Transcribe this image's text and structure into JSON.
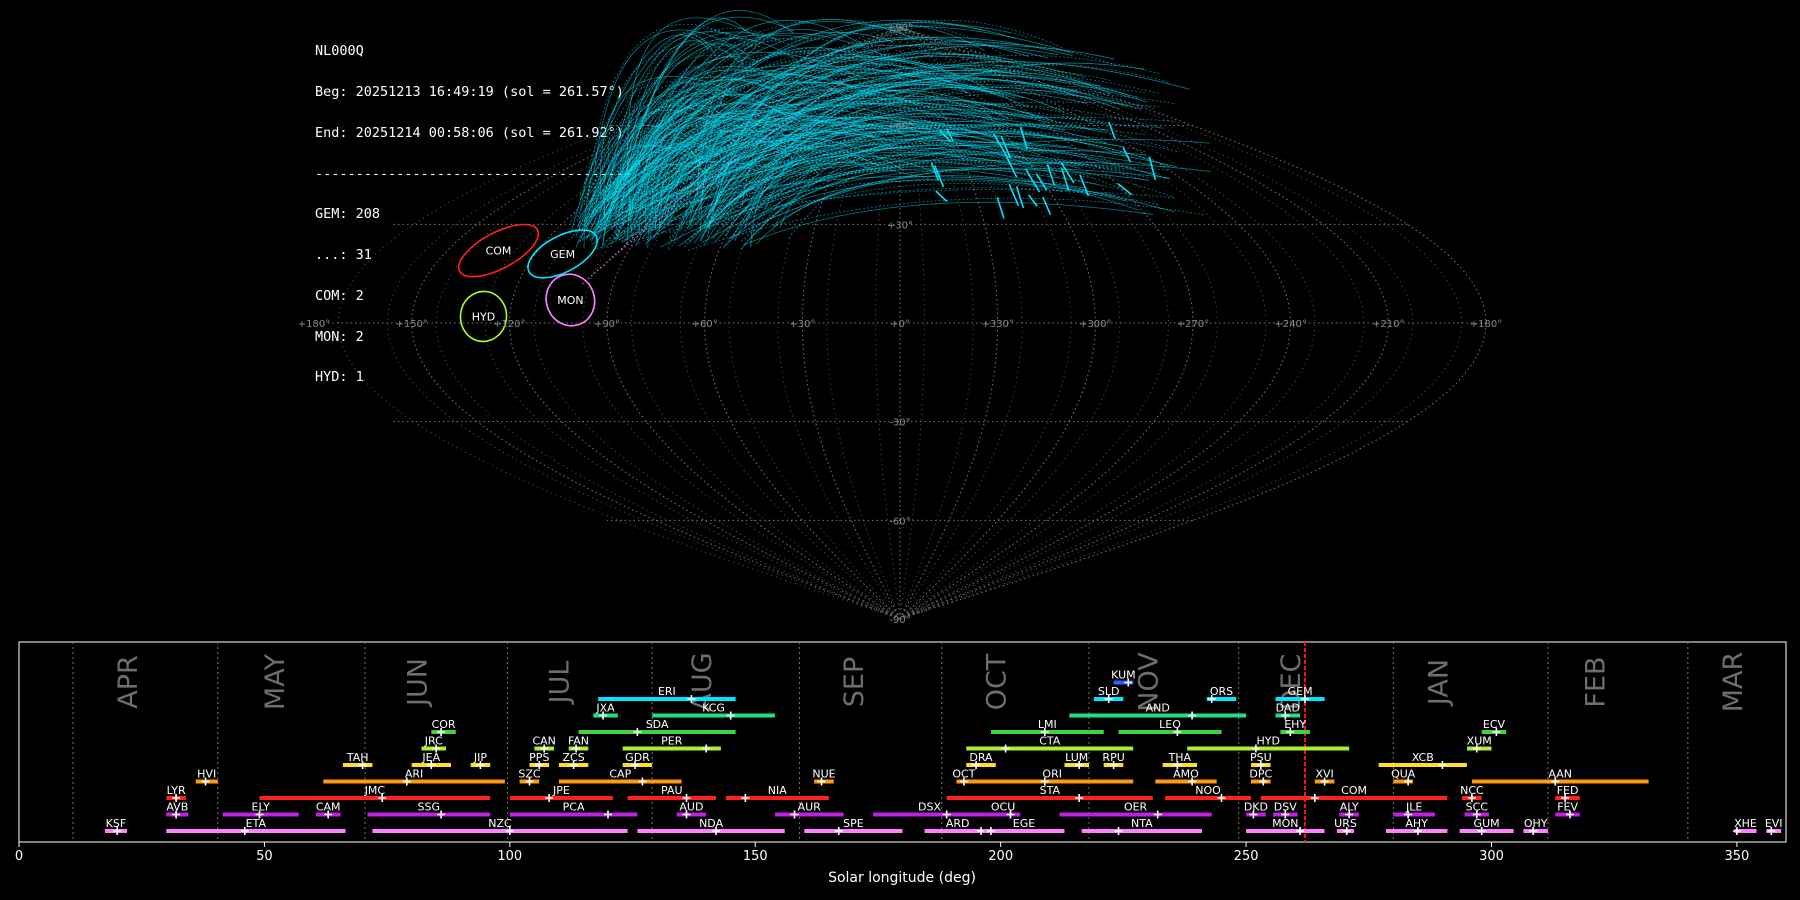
{
  "stats": {
    "station": "NL000Q",
    "begin": "Beg: 20251213 16:49:19 (sol = 261.57°)",
    "end": "End: 20251214 00:58:06 (sol = 261.92°)",
    "separator": "---------------------------------------",
    "counts": [
      "GEM: 208",
      "...: 31",
      "COM: 2",
      "MON: 2",
      "HYD: 1"
    ]
  },
  "chart_data": [
    {
      "type": "scatter",
      "projection": "sinusoidal",
      "grid": true,
      "lon_tick_labels": [
        "+180°",
        "+150°",
        "+120°",
        "+90°",
        "+60°",
        "+30°",
        "+0°",
        "+330°",
        "+300°",
        "+270°",
        "+240°",
        "+210°",
        "+180°"
      ],
      "lat_tick_labels": [
        "+90°",
        "+60°",
        "+30°",
        "-30°",
        "-60°",
        "-90°"
      ],
      "radiants": [
        {
          "code": "COM",
          "color": "#ff2020",
          "ra": 133,
          "dec": 22
        },
        {
          "code": "GEM",
          "color": "#00e5ff",
          "ra": 111,
          "dec": 21
        },
        {
          "code": "MON",
          "color": "#ff80ff",
          "ra": 102,
          "dec": 7
        },
        {
          "code": "HYD",
          "color": "#b0ff20",
          "ra": 128,
          "dec": 2
        }
      ],
      "colors": {
        "sporadic": "#ff80ff",
        "gem": "#00e5ff"
      }
    },
    {
      "type": "bar",
      "orientation": "horizontal",
      "xlabel": "Solar longitude (deg)",
      "xlim": [
        0,
        360
      ],
      "x_ticks": [
        0,
        50,
        100,
        150,
        200,
        250,
        300,
        350
      ],
      "months": [
        {
          "label": "APR",
          "center": 24
        },
        {
          "label": "MAY",
          "center": 54
        },
        {
          "label": "JUN",
          "center": 83
        },
        {
          "label": "JUL",
          "center": 112
        },
        {
          "label": "AUG",
          "center": 141
        },
        {
          "label": "SEP",
          "center": 172
        },
        {
          "label": "OCT",
          "center": 201
        },
        {
          "label": "NOV",
          "center": 232
        },
        {
          "label": "DEC",
          "center": 261
        },
        {
          "label": "JAN",
          "center": 291
        },
        {
          "label": "FEB",
          "center": 323
        },
        {
          "label": "MAR",
          "center": 351
        }
      ],
      "month_boundaries": [
        11,
        40.5,
        70.5,
        99.5,
        129,
        159,
        188,
        218,
        248.5,
        280,
        311.5,
        340
      ],
      "current_sol": 262,
      "showers": [
        {
          "code": "KSF",
          "start": 17.5,
          "end": 22,
          "peak": 20,
          "row": 0,
          "color": "#ff80ff"
        },
        {
          "code": "ETA",
          "start": 30,
          "end": 66.5,
          "peak": 46,
          "row": 0,
          "color": "#ff80ff"
        },
        {
          "code": "NZC",
          "start": 72,
          "end": 124,
          "peak": 100,
          "row": 0,
          "color": "#ff80ff"
        },
        {
          "code": "NDA",
          "start": 126,
          "end": 156,
          "peak": 142,
          "row": 0,
          "color": "#ff80ff"
        },
        {
          "code": "SPE",
          "start": 160,
          "end": 180,
          "peak": 167,
          "row": 0,
          "color": "#ff80ff"
        },
        {
          "code": "ARD",
          "start": 184.5,
          "end": 198,
          "peak": 196,
          "row": 0,
          "color": "#ff80ff"
        },
        {
          "code": "EGE",
          "start": 196.5,
          "end": 213,
          "peak": 198,
          "row": 0,
          "color": "#ff80ff"
        },
        {
          "code": "NTA",
          "start": 216.5,
          "end": 241,
          "peak": 224,
          "row": 0,
          "color": "#ff80ff"
        },
        {
          "code": "MON",
          "start": 250,
          "end": 266,
          "peak": 261,
          "row": 0,
          "color": "#ff80ff"
        },
        {
          "code": "URS",
          "start": 268.5,
          "end": 272,
          "peak": 270.5,
          "row": 0,
          "color": "#ff80ff"
        },
        {
          "code": "AHY",
          "start": 278.5,
          "end": 291,
          "peak": 285,
          "row": 0,
          "color": "#ff80ff"
        },
        {
          "code": "GUM",
          "start": 293.5,
          "end": 304.5,
          "peak": 298,
          "row": 0,
          "color": "#ff80ff"
        },
        {
          "code": "OHY",
          "start": 306.5,
          "end": 311.5,
          "peak": 308.5,
          "row": 0,
          "color": "#ff80ff"
        },
        {
          "code": "XHE",
          "start": 349.5,
          "end": 354,
          "peak": 350,
          "row": 0,
          "color": "#ff80ff"
        },
        {
          "code": "EVI",
          "start": 356,
          "end": 359,
          "peak": 357,
          "row": 0,
          "color": "#ff80ff"
        },
        {
          "code": "AVB",
          "start": 30,
          "end": 34.5,
          "peak": 32,
          "row": 1,
          "color": "#c020e0"
        },
        {
          "code": "ELY",
          "start": 41.5,
          "end": 57,
          "peak": 49,
          "row": 1,
          "color": "#c020e0"
        },
        {
          "code": "CAM",
          "start": 60.5,
          "end": 65.5,
          "peak": 63,
          "row": 1,
          "color": "#c020e0"
        },
        {
          "code": "SSG",
          "start": 71,
          "end": 96,
          "peak": 86,
          "row": 1,
          "color": "#c020e0"
        },
        {
          "code": "PCA",
          "start": 100,
          "end": 126,
          "peak": 120,
          "row": 1,
          "color": "#c020e0"
        },
        {
          "code": "AUD",
          "start": 134,
          "end": 140,
          "peak": 136,
          "row": 1,
          "color": "#c020e0"
        },
        {
          "code": "AUR",
          "start": 154,
          "end": 168,
          "peak": 158,
          "row": 1,
          "color": "#c020e0"
        },
        {
          "code": "DSX",
          "start": 174,
          "end": 197,
          "peak": 189,
          "row": 1,
          "color": "#c020e0"
        },
        {
          "code": "OCU",
          "start": 197,
          "end": 204,
          "peak": 202,
          "row": 1,
          "color": "#c020e0"
        },
        {
          "code": "OER",
          "start": 212,
          "end": 243,
          "peak": 232,
          "row": 1,
          "color": "#c020e0"
        },
        {
          "code": "DKD",
          "start": 250,
          "end": 254,
          "peak": 251.5,
          "row": 1,
          "color": "#c020e0"
        },
        {
          "code": "DSV",
          "start": 255.5,
          "end": 260.5,
          "peak": 258,
          "row": 1,
          "color": "#c020e0"
        },
        {
          "code": "ALY",
          "start": 269,
          "end": 273,
          "peak": 271,
          "row": 1,
          "color": "#c020e0"
        },
        {
          "code": "JLE",
          "start": 280,
          "end": 288.5,
          "peak": 283,
          "row": 1,
          "color": "#c020e0"
        },
        {
          "code": "SCC",
          "start": 294.5,
          "end": 299.5,
          "peak": 297,
          "row": 1,
          "color": "#c020e0"
        },
        {
          "code": "FEV",
          "start": 313,
          "end": 318,
          "peak": 316,
          "row": 1,
          "color": "#c020e0"
        },
        {
          "code": "LYR",
          "start": 30,
          "end": 34,
          "peak": 32,
          "row": 2,
          "color": "#ff2020"
        },
        {
          "code": "JMC",
          "start": 49,
          "end": 96,
          "peak": 74,
          "row": 2,
          "color": "#ff2020"
        },
        {
          "code": "JPE",
          "start": 100,
          "end": 121,
          "peak": 108,
          "row": 2,
          "color": "#ff2020"
        },
        {
          "code": "PAU",
          "start": 124,
          "end": 142,
          "peak": 136,
          "row": 2,
          "color": "#ff2020"
        },
        {
          "code": "NIA",
          "start": 144,
          "end": 165,
          "peak": 148,
          "row": 2,
          "color": "#ff2020"
        },
        {
          "code": "STA",
          "start": 189,
          "end": 231,
          "peak": 216,
          "row": 2,
          "color": "#ff2020"
        },
        {
          "code": "NOO",
          "start": 233.5,
          "end": 251,
          "peak": 245,
          "row": 2,
          "color": "#ff2020"
        },
        {
          "code": "COM",
          "start": 253,
          "end": 291,
          "peak": 264,
          "row": 2,
          "color": "#ff2020"
        },
        {
          "code": "NCC",
          "start": 294,
          "end": 298,
          "peak": 296,
          "row": 2,
          "color": "#ff2020"
        },
        {
          "code": "FED",
          "start": 313,
          "end": 318,
          "peak": 315,
          "row": 2,
          "color": "#ff2020"
        },
        {
          "code": "HVI",
          "start": 36,
          "end": 40.5,
          "peak": 38,
          "row": 3,
          "color": "#ff9a10"
        },
        {
          "code": "ARI",
          "start": 62,
          "end": 99,
          "peak": 79,
          "row": 3,
          "color": "#ff9a10"
        },
        {
          "code": "SZC",
          "start": 102,
          "end": 106,
          "peak": 104,
          "row": 3,
          "color": "#ff9a10"
        },
        {
          "code": "CAP",
          "start": 110,
          "end": 135,
          "peak": 127,
          "row": 3,
          "color": "#ff9a10"
        },
        {
          "code": "NUE",
          "start": 162,
          "end": 166,
          "peak": 163.5,
          "row": 3,
          "color": "#ff9a10"
        },
        {
          "code": "OCT",
          "start": 191,
          "end": 194,
          "peak": 192.5,
          "row": 3,
          "color": "#ff9a10"
        },
        {
          "code": "ORI",
          "start": 194,
          "end": 227,
          "peak": 209,
          "row": 3,
          "color": "#ff9a10"
        },
        {
          "code": "AMO",
          "start": 231.5,
          "end": 244,
          "peak": 239,
          "row": 3,
          "color": "#ff9a10"
        },
        {
          "code": "DPC",
          "start": 251,
          "end": 255,
          "peak": 253.5,
          "row": 3,
          "color": "#ff9a10"
        },
        {
          "code": "XVI",
          "start": 264,
          "end": 268,
          "peak": 266,
          "row": 3,
          "color": "#ff9a10"
        },
        {
          "code": "QUA",
          "start": 280,
          "end": 284,
          "peak": 283,
          "row": 3,
          "color": "#ff9a10"
        },
        {
          "code": "AAN",
          "start": 296,
          "end": 332,
          "peak": 313,
          "row": 3,
          "color": "#ff9a10"
        },
        {
          "code": "TAH",
          "start": 66,
          "end": 72,
          "peak": 70,
          "row": 4,
          "color": "#ffe020"
        },
        {
          "code": "JEA",
          "start": 80,
          "end": 88,
          "peak": 84,
          "row": 4,
          "color": "#ffe020"
        },
        {
          "code": "JIP",
          "start": 92,
          "end": 96,
          "peak": 94,
          "row": 4,
          "color": "#ffe020"
        },
        {
          "code": "PPS",
          "start": 104,
          "end": 108,
          "peak": 106,
          "row": 4,
          "color": "#ffe020"
        },
        {
          "code": "ZCS",
          "start": 110,
          "end": 116,
          "peak": 113,
          "row": 4,
          "color": "#ffe020"
        },
        {
          "code": "GDR",
          "start": 123,
          "end": 129,
          "peak": 125.5,
          "row": 4,
          "color": "#ffe020"
        },
        {
          "code": "DRA",
          "start": 193,
          "end": 199,
          "peak": 195,
          "row": 4,
          "color": "#ffe020"
        },
        {
          "code": "LUM",
          "start": 213,
          "end": 218,
          "peak": 216,
          "row": 4,
          "color": "#ffe020"
        },
        {
          "code": "RPU",
          "start": 221,
          "end": 225,
          "peak": 223,
          "row": 4,
          "color": "#ffe020"
        },
        {
          "code": "THA",
          "start": 233,
          "end": 240,
          "peak": 236,
          "row": 4,
          "color": "#ffe020"
        },
        {
          "code": "PSU",
          "start": 251,
          "end": 255,
          "peak": 253,
          "row": 4,
          "color": "#ffe020"
        },
        {
          "code": "XCB",
          "start": 277,
          "end": 295,
          "peak": 290,
          "row": 4,
          "color": "#ffe020"
        },
        {
          "code": "JRC",
          "start": 82,
          "end": 87,
          "peak": 85,
          "row": 5,
          "color": "#a8f030"
        },
        {
          "code": "CAN",
          "start": 105,
          "end": 109,
          "peak": 107,
          "row": 5,
          "color": "#a8f030"
        },
        {
          "code": "FAN",
          "start": 112,
          "end": 116,
          "peak": 113.5,
          "row": 5,
          "color": "#a8f030"
        },
        {
          "code": "PER",
          "start": 123,
          "end": 143,
          "peak": 140,
          "row": 5,
          "color": "#a8f030"
        },
        {
          "code": "CTA",
          "start": 193,
          "end": 227,
          "peak": 201,
          "row": 5,
          "color": "#a8f030"
        },
        {
          "code": "HYD",
          "start": 238,
          "end": 271,
          "peak": 252,
          "row": 5,
          "color": "#a8f030"
        },
        {
          "code": "XUM",
          "start": 295,
          "end": 300,
          "peak": 297,
          "row": 5,
          "color": "#a8f030"
        },
        {
          "code": "COR",
          "start": 84,
          "end": 89,
          "peak": 86,
          "row": 6,
          "color": "#40d040"
        },
        {
          "code": "SDA",
          "start": 114,
          "end": 146,
          "peak": 126,
          "row": 6,
          "color": "#40d040"
        },
        {
          "code": "LMI",
          "start": 198,
          "end": 221,
          "peak": 209,
          "row": 6,
          "color": "#40d040"
        },
        {
          "code": "LEO",
          "start": 224,
          "end": 245,
          "peak": 236,
          "row": 6,
          "color": "#40d040"
        },
        {
          "code": "EHY",
          "start": 257,
          "end": 263,
          "peak": 259,
          "row": 6,
          "color": "#40d040"
        },
        {
          "code": "ECV",
          "start": 298,
          "end": 303,
          "peak": 301,
          "row": 6,
          "color": "#40d040"
        },
        {
          "code": "JXA",
          "start": 117,
          "end": 122,
          "peak": 119,
          "row": 7,
          "color": "#20e080"
        },
        {
          "code": "KCG",
          "start": 129,
          "end": 154,
          "peak": 145,
          "row": 7,
          "color": "#20e080"
        },
        {
          "code": "AND",
          "start": 214,
          "end": 250,
          "peak": 239,
          "row": 7,
          "color": "#20e080"
        },
        {
          "code": "DAD",
          "start": 256,
          "end": 261,
          "peak": 258,
          "row": 7,
          "color": "#20e080"
        },
        {
          "code": "ERI",
          "start": 118,
          "end": 146,
          "peak": 137,
          "row": 8,
          "color": "#00e5ff"
        },
        {
          "code": "SLD",
          "start": 219,
          "end": 225,
          "peak": 222,
          "row": 8,
          "color": "#00e5ff"
        },
        {
          "code": "ORS",
          "start": 242,
          "end": 248,
          "peak": 243,
          "row": 8,
          "color": "#00e5ff"
        },
        {
          "code": "GEM",
          "start": 256,
          "end": 266,
          "peak": 262,
          "row": 8,
          "color": "#00e5ff"
        },
        {
          "code": "KUM",
          "start": 223,
          "end": 227,
          "peak": 226,
          "row": 9,
          "color": "#3060ff"
        }
      ]
    }
  ]
}
